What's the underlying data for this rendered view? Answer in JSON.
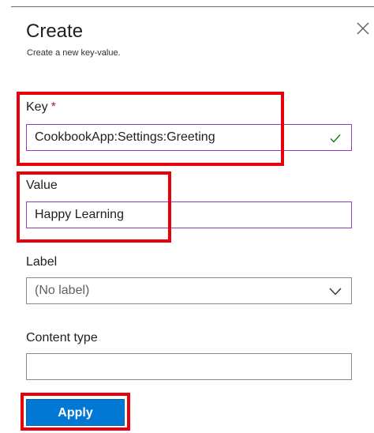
{
  "header": {
    "title": "Create",
    "subtitle": "Create a new key-value.",
    "close_icon": "close-icon"
  },
  "form": {
    "key": {
      "label": "Key",
      "required_marker": "*",
      "value": "CookbookApp:Settings:Greeting",
      "status_icon": "checkmark-icon"
    },
    "value": {
      "label": "Value",
      "value": "Happy Learning"
    },
    "label": {
      "label": "Label",
      "selected": "(No label)",
      "dropdown_icon": "chevron-down-icon"
    },
    "content_type": {
      "label": "Content type",
      "value": ""
    }
  },
  "actions": {
    "apply_label": "Apply"
  },
  "colors": {
    "accent": "#0078d4",
    "focus_border": "#8e3fb8",
    "highlight": "#e8000b",
    "required": "#a4262c",
    "valid_check": "#107c10"
  }
}
